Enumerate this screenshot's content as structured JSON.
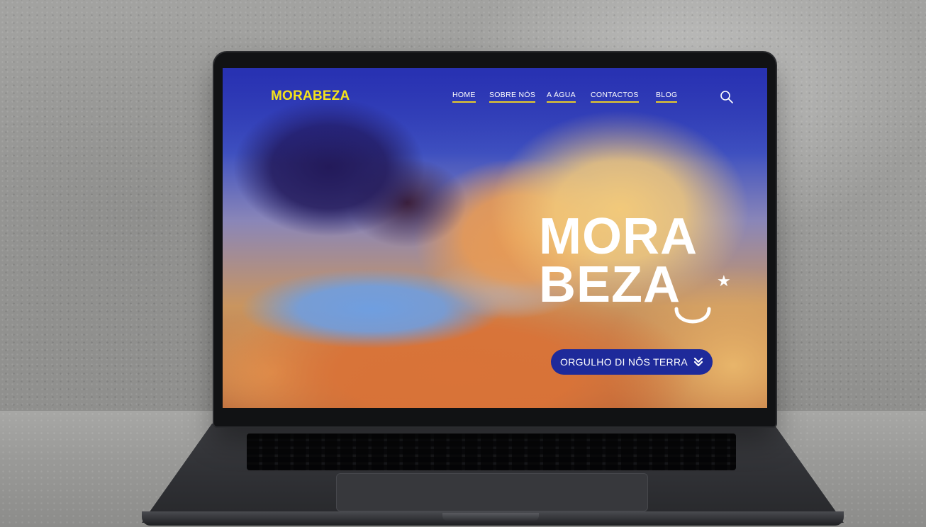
{
  "site": {
    "logo": "MORABEZA",
    "nav": [
      {
        "label": "HOME"
      },
      {
        "label": "SOBRE NÓS"
      },
      {
        "label": "A ÁGUA"
      },
      {
        "label": "CONTACTOS"
      },
      {
        "label": "BLOG"
      }
    ],
    "search_icon": "search-icon",
    "hero": {
      "title_line1": "MORA",
      "title_line2": "BEZA",
      "star_glyph": "★",
      "cta_label": "ORGULHO DI NÔS TERRA",
      "cta_icon": "double-chevron-down-icon"
    },
    "colors": {
      "accent_yellow": "#f5e21a",
      "cta_blue": "#1e2a9a",
      "nav_underline": "#e8cc2a"
    }
  }
}
